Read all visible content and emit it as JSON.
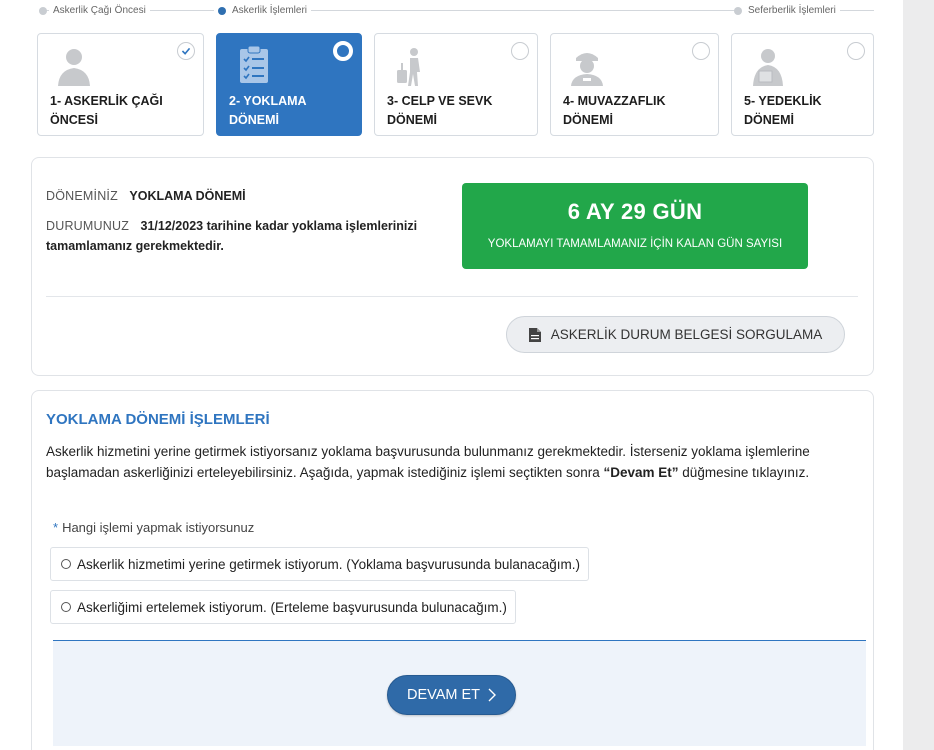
{
  "progress": {
    "stage1_label": "Askerlik Çağı Öncesi",
    "stage2_label": "Askerlik İşlemleri",
    "stage3_label": "Seferberlik İşlemleri"
  },
  "steps": [
    {
      "title_line1": "1- ASKERLİK ÇAĞI",
      "title_line2": "ÖNCESİ",
      "icon": "person-silhouette-icon",
      "state": "completed"
    },
    {
      "title_line1": "2- YOKLAMA",
      "title_line2": "DÖNEMİ",
      "icon": "clipboard-checklist-icon",
      "state": "active"
    },
    {
      "title_line1": "3- CELP VE SEVK",
      "title_line2": "DÖNEMİ",
      "icon": "traveler-suitcase-icon",
      "state": "pending"
    },
    {
      "title_line1": "4- MUVAZZAFLIK",
      "title_line2": "DÖNEMİ",
      "icon": "soldier-icon",
      "state": "pending"
    },
    {
      "title_line1": "5- YEDEKLİK",
      "title_line2": "DÖNEMİ",
      "icon": "reservist-icon",
      "state": "pending"
    }
  ],
  "status": {
    "period_key": "DÖNEMİNİZ",
    "period_value": "YOKLAMA DÖNEMİ",
    "status_key": "DURUMUNUZ",
    "status_value_line1": "31/12/2023 tarihine kadar yoklama işlemlerinizi",
    "status_value_line2": "tamamlamanız gerekmektedir.",
    "countdown_value": "6 AY 29 GÜN",
    "countdown_caption": "YOKLAMAYI TAMAMLAMANIZ İÇİN KALAN GÜN SAYISI",
    "query_button_label": "ASKERLİK DURUM BELGESİ SORGULAMA"
  },
  "operations": {
    "title": "YOKLAMA DÖNEMİ İŞLEMLERİ",
    "description_part1": "Askerlik hizmetini yerine getirmek istiyorsanız yoklama başvurusunda bulunmanız gerekmektedir. İsterseniz yoklama işlemlerine başlamadan askerliğinizi erteleyebilirsiniz. Aşağıda, yapmak istediğiniz işlemi seçtikten sonra ",
    "description_bold": "“Devam Et”",
    "description_part2": " düğmesine tıklayınız.",
    "question_required": "*",
    "question_label": "Hangi işlemi yapmak istiyorsunuz",
    "options": [
      {
        "label": "Askerlik hizmetimi yerine getirmek istiyorum. (Yoklama başvurusunda bulanacağım.)"
      },
      {
        "label": "Askerliğimi ertelemek istiyorum. (Erteleme başvurusunda bulunacağım.)"
      }
    ],
    "continue_label": "DEVAM ET"
  },
  "colors": {
    "accent": "#2f75c0",
    "countdown_bg": "#22a74a",
    "continue_bg": "#2f6aa8"
  }
}
